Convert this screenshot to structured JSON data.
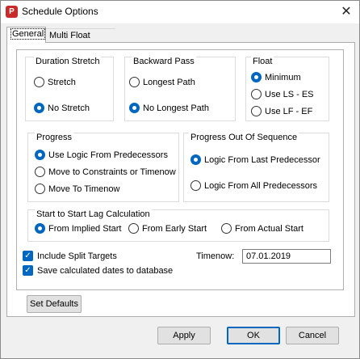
{
  "window": {
    "title": "Schedule Options",
    "app_icon_glyph": "P",
    "close_glyph": "✕"
  },
  "tabs": [
    {
      "label": "General",
      "active": true
    },
    {
      "label": "Multi Float Paths",
      "active": false
    }
  ],
  "duration_stretch": {
    "title": "Duration Stretch",
    "options": [
      {
        "label": "Stretch",
        "selected": false
      },
      {
        "label": "No Stretch",
        "selected": true
      }
    ]
  },
  "backward_pass": {
    "title": "Backward Pass",
    "options": [
      {
        "label": "Longest Path",
        "selected": false
      },
      {
        "label": "No Longest Path",
        "selected": true
      }
    ]
  },
  "float": {
    "title": "Float",
    "options": [
      {
        "label": "Minimum",
        "selected": true
      },
      {
        "label": "Use LS - ES",
        "selected": false
      },
      {
        "label": "Use LF - EF",
        "selected": false
      }
    ]
  },
  "progress": {
    "title": "Progress",
    "options": [
      {
        "label": "Use Logic From Predecessors",
        "selected": true
      },
      {
        "label": "Move to Constraints or Timenow",
        "selected": false
      },
      {
        "label": "Move To Timenow",
        "selected": false
      }
    ]
  },
  "progress_out_of_sequence": {
    "title": "Progress Out Of Sequence",
    "options": [
      {
        "label": "Logic From Last Predecessor",
        "selected": true
      },
      {
        "label": "Logic From All Predecessors",
        "selected": false
      }
    ]
  },
  "sts_lag": {
    "title": "Start to Start Lag Calculation",
    "options": [
      {
        "label": "From Implied  Start",
        "selected": true
      },
      {
        "label": "From Early Start",
        "selected": false
      },
      {
        "label": "From Actual Start",
        "selected": false
      }
    ]
  },
  "checkboxes": [
    {
      "label": "Include Split Targets",
      "checked": true
    },
    {
      "label": "Save calculated dates to database",
      "checked": true
    }
  ],
  "timenow": {
    "label": "Timenow:",
    "value": "07.01.2019"
  },
  "buttons": {
    "set_defaults": "Set Defaults",
    "apply": "Apply",
    "ok": "OK",
    "cancel": "Cancel"
  },
  "colors": {
    "accent": "#0067c0",
    "app_icon": "#c92a2a"
  }
}
